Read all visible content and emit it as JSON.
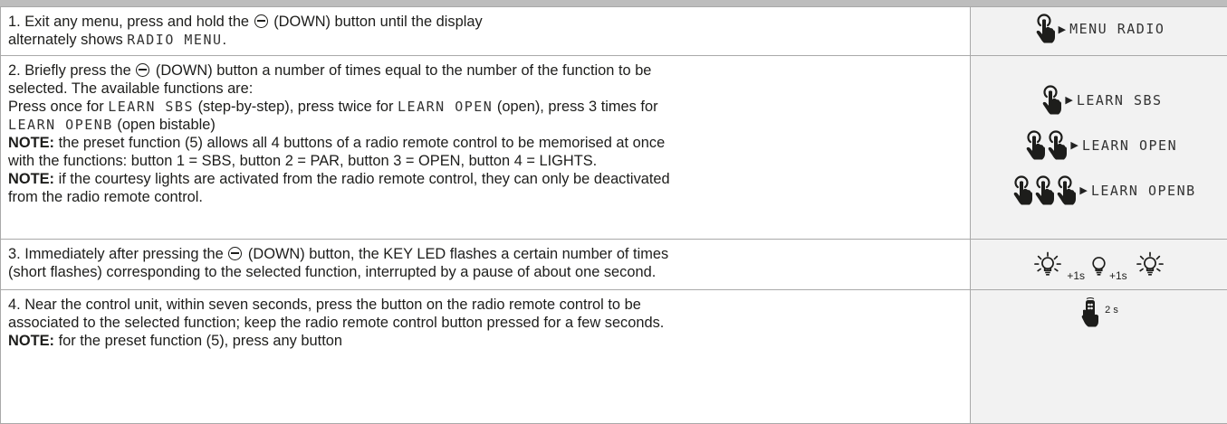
{
  "rows": [
    {
      "step1_a": "1. Exit any menu, press and hold the",
      "step1_b": "(DOWN) button until the display",
      "step1_c": "alternately shows",
      "step1_lcd": "RADIO MENU",
      "step1_end": ".",
      "fig_label": "MENU RADIO"
    },
    {
      "l1_a": "2. Briefly press the",
      "l1_b": "(DOWN) button a number of times equal to the number of the function to be",
      "l2": "selected. The available functions are:",
      "l3_a": "Press once for",
      "l3_lcd1": "LEARN SBS",
      "l3_b": "(step-by-step), press twice for",
      "l3_lcd2": "LEARN OPEN",
      "l3_c": "(open), press 3 times for",
      "l4_lcd": "LEARN OPENB",
      "l4_b": "(open bistable)",
      "note1_label": "NOTE:",
      "note1_a": "the preset function (5) allows all 4 buttons of a radio remote control to be memorised at once",
      "note1_b": "with the functions: button 1 = SBS, button 2 = PAR, button 3 = OPEN, button 4 = LIGHTS.",
      "note2_label": "NOTE:",
      "note2_a": "if the courtesy lights are activated from the radio remote control, they can only be deactivated",
      "note2_b": "from the radio remote control.",
      "fig_labels": [
        "LEARN SBS",
        "LEARN OPEN",
        "LEARN OPENB"
      ]
    },
    {
      "l1_a": "3. Immediately after pressing the",
      "l1_b": "(DOWN) button, the KEY LED flashes a certain number of times",
      "l2": "(short flashes) corresponding to the selected function, interrupted by a pause of about one second.",
      "time1": "+1s",
      "time2": "+1s"
    },
    {
      "l1": "4. Near the control unit, within seven seconds, press the button on the radio remote control to be",
      "l2": "associated to the selected function; keep the radio remote control button pressed for a few seconds.",
      "note_label": "NOTE:",
      "note_text": "for the preset function (5), press any button",
      "hold_time": "2 s"
    }
  ],
  "icons": {
    "down_button": "minus-circle-icon",
    "hand": "hand-press-icon",
    "arrow": "right-triangle-icon",
    "bulb_on": "bulb-on-icon",
    "bulb_off": "bulb-off-icon",
    "remote": "remote-in-hand-icon"
  }
}
